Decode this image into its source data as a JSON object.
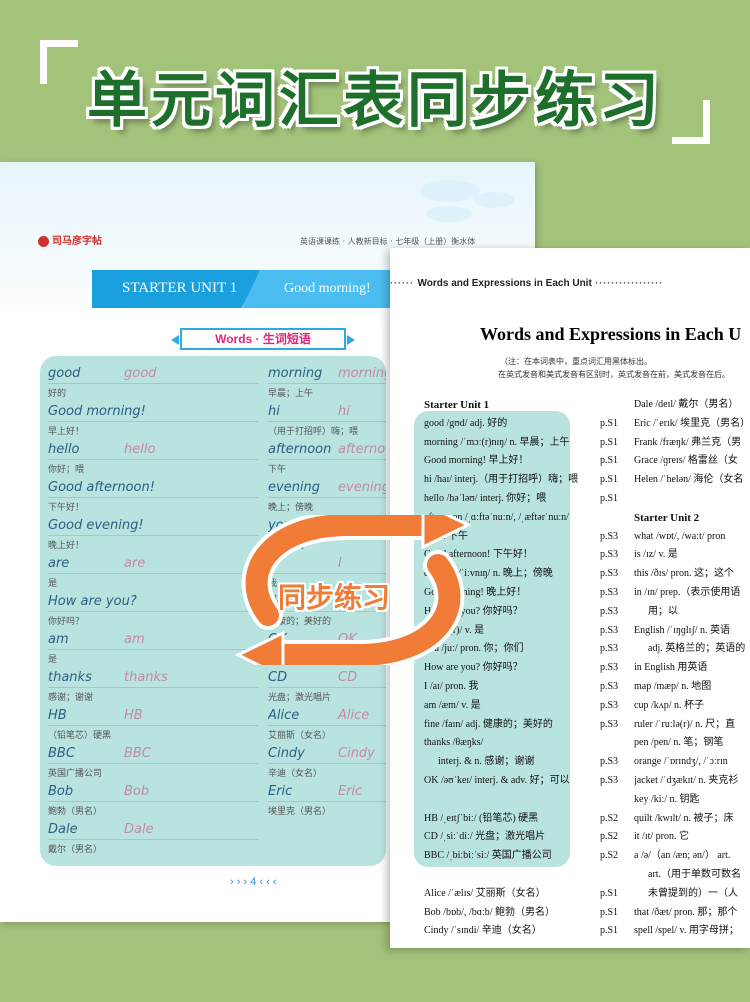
{
  "banner": {
    "title": "单元词汇表同步练习"
  },
  "left_page": {
    "brand": "司马彦字帖",
    "header": "英语课课练 · 人教新目标 · 七年级（上册）衡水体",
    "unit_title": "STARTER UNIT 1",
    "unit_subtitle": "Good morning!",
    "words_label": "Words · 生词短语",
    "page_number": "4",
    "col1": [
      {
        "word": "good",
        "trace": "good",
        "meaning": "好的"
      },
      {
        "word": "Good morning!",
        "trace": "",
        "meaning": "早上好！"
      },
      {
        "word": "hello",
        "trace": "hello",
        "meaning": "你好；喂"
      },
      {
        "word": "Good afternoon!",
        "trace": "",
        "meaning": "下午好！"
      },
      {
        "word": "Good evening!",
        "trace": "",
        "meaning": "晚上好！"
      },
      {
        "word": "are",
        "trace": "are",
        "meaning": "是"
      },
      {
        "word": "How are you?",
        "trace": "",
        "meaning": "你好吗？"
      },
      {
        "word": "am",
        "trace": "am",
        "meaning": "是"
      },
      {
        "word": "thanks",
        "trace": "thanks",
        "meaning": "感谢；谢谢"
      },
      {
        "word": "HB",
        "trace": "HB",
        "meaning": "（铅笔芯）硬黑"
      },
      {
        "word": "BBC",
        "trace": "BBC",
        "meaning": "英国广播公司"
      },
      {
        "word": "Bob",
        "trace": "Bob",
        "meaning": "鲍勃（男名）"
      },
      {
        "word": "Dale",
        "trace": "Dale",
        "meaning": "戴尔（男名）"
      }
    ],
    "col2": [
      {
        "word": "morning",
        "trace": "morning",
        "meaning": "早晨；上午"
      },
      {
        "word": "hi",
        "trace": "hi",
        "meaning": "（用于打招呼）嗨；喂"
      },
      {
        "word": "afternoon",
        "trace": "afternoon",
        "meaning": "下午"
      },
      {
        "word": "evening",
        "trace": "evening",
        "meaning": "晚上；傍晚"
      },
      {
        "word": "you",
        "trace": "you",
        "meaning": "你；你们"
      },
      {
        "word": "I",
        "trace": "I",
        "meaning": "我"
      },
      {
        "word": "fine",
        "trace": "fine",
        "meaning": "健康的；美好的"
      },
      {
        "word": "OK",
        "trace": "OK",
        "meaning": "好；可以"
      },
      {
        "word": "CD",
        "trace": "CD",
        "meaning": "光盘；激光唱片"
      },
      {
        "word": "Alice",
        "trace": "Alice",
        "meaning": "艾丽斯（女名）"
      },
      {
        "word": "Cindy",
        "trace": "Cindy",
        "meaning": "辛迪（女名）"
      },
      {
        "word": "Eric",
        "trace": "Eric",
        "meaning": "埃里克（男名）"
      }
    ]
  },
  "right_page": {
    "header_bar": "Words and Expressions in Each Unit",
    "title": "Words and Expressions in Each U",
    "note_line1": "（注：在本词表中，重点词汇用黑体标出。",
    "note_line2": "在英式发音和美式发音有区别时，英式发音在前，美式发音在后。",
    "colA_heading": "Starter Unit 1",
    "colA": [
      {
        "text": "good /gʊd/ adj. 好的",
        "page": "p.S1"
      },
      {
        "text": "morning /ˈmɔː(r)nɪŋ/ n. 早晨；上午",
        "page": "p.S1"
      },
      {
        "text": "Good morning! 早上好！",
        "page": "p.S1"
      },
      {
        "text": "hi /haɪ/ interj.（用于打招呼）嗨；喂",
        "page": "p.S1"
      },
      {
        "text": "hello /həˈləʊ/ interj. 你好；喂",
        "page": "p.S1"
      },
      {
        "text": "afternoon /ˌɑːftəˈnuːn/, /ˌæftərˈnuːn/",
        "page": ""
      },
      {
        "text": "n. 下午",
        "page": "p.S3"
      },
      {
        "text": "Good afternoon! 下午好！",
        "page": "p.S3"
      },
      {
        "text": "evening /ˈiːvnɪŋ/ n. 晚上；傍晚",
        "page": "p.S3"
      },
      {
        "text": "Good evening! 晚上好！",
        "page": "p.S3"
      },
      {
        "text": "How are you? 你好吗？",
        "page": "p.S3"
      },
      {
        "text": "are /ɑː(r)/ v. 是",
        "page": "p.S3"
      },
      {
        "text": "you /juː/ pron. 你；你们",
        "page": "p.S3"
      },
      {
        "text": "How are you? 你好吗？",
        "page": "p.S3"
      },
      {
        "text": "I /aɪ/ pron. 我",
        "page": "p.S3"
      },
      {
        "text": "am /æm/ v. 是",
        "page": "p.S3"
      },
      {
        "text": "fine /faɪn/ adj. 健康的；美好的",
        "page": "p.S3"
      },
      {
        "text": "thanks /θæŋks/",
        "page": ""
      },
      {
        "text": "interj. & n. 感谢；谢谢",
        "page": "p.S3"
      },
      {
        "text": "OK /əʊˈkeɪ/ interj. & adv. 好；可以",
        "page": "p.S3"
      },
      {
        "text": "",
        "page": ""
      },
      {
        "text": "HB /ˌeɪtʃˈbiː/ (铅笔芯) 硬黑",
        "page": "p.S2"
      },
      {
        "text": "CD /ˌsiːˈdiː/ 光盘；激光唱片",
        "page": "p.S2"
      },
      {
        "text": "BBC /ˌbiːbiːˈsiː/ 英国广播公司",
        "page": "p.S2"
      },
      {
        "text": "",
        "page": ""
      },
      {
        "text": "Alice /ˈælɪs/ 艾丽斯（女名）",
        "page": "p.S1"
      },
      {
        "text": "Bob /bɒb/, /bɑːb/ 鲍勃（男名）",
        "page": "p.S1"
      },
      {
        "text": "Cindy /ˈsɪndi/ 辛迪（女名）",
        "page": "p.S1"
      }
    ],
    "colB": [
      "Dale /deɪl/ 戴尔（男名）",
      "Eric /ˈerɪk/ 埃里克（男名）",
      "Frank /fræŋk/ 弗兰克（男",
      "Grace /ɡreɪs/ 格雷丝（女",
      "Helen /ˈhelən/ 海伦（女名",
      "",
      "Starter Unit 2",
      "what /wɒt/, /waːt/ pron",
      "is /ɪz/ v. 是",
      "this /ðɪs/ pron. 这；这个",
      "in /ɪn/ prep.（表示使用语",
      "用；以",
      "English /ˈɪŋɡlɪʃ/ n. 英语",
      "adj. 英格兰的；英语的",
      "in English 用英语",
      "map /mæp/ n. 地图",
      "cup /kʌp/ n. 杯子",
      "ruler /ˈruːlə(r)/ n. 尺；直",
      "pen /pen/ n. 笔；钢笔",
      "orange /ˈɒrɪndʒ/, /ˈɔːrɪn",
      "jacket /ˈdʒækɪt/ n. 夹克衫",
      "key /kiː/ n. 钥匙",
      "quilt /kwɪlt/ n. 被子；床",
      "it /ɪt/ pron. 它",
      "a /ə/（an /æn; ən/） art.",
      "art.（用于单数可数名",
      "未曾提到的）一（人",
      "that /ðæt/ pron. 那；那个",
      "spell /spel/ v. 用字母拼；"
    ]
  },
  "sync_label": "同步练习",
  "colors": {
    "background": "#a3c27a",
    "title_green": "#1e6e2c",
    "unit_blue": "#1aa0df",
    "highlight": "#b9e3df",
    "arrow_orange": "#f07c37"
  }
}
